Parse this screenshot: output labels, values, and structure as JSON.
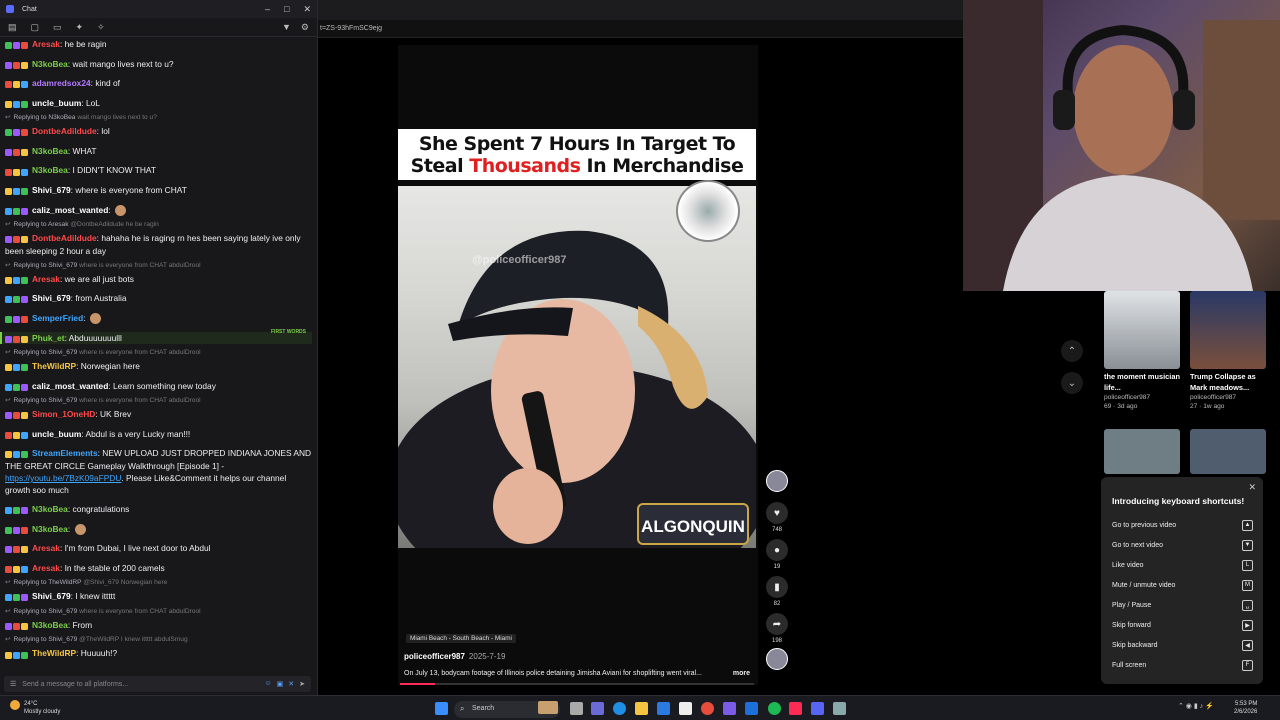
{
  "chat": {
    "window_title": "Chat",
    "input_placeholder": "Send a message to all platforms...",
    "messages": [
      {
        "user": "Aresak",
        "color": "#ff4a4a",
        "text": "he be ragin"
      },
      {
        "user": "N3koBea",
        "color": "#7bcf48",
        "text": "wait mango lives next to u?"
      },
      {
        "user": "adamredsox24",
        "color": "#b47aff",
        "text": "kind of"
      },
      {
        "user": "uncle_buum",
        "color": "#ffffff",
        "text": "LoL"
      },
      {
        "reply": "Replying to N3koBea",
        "reply_text": "wait mango lives next to u?"
      },
      {
        "user": "DontbeAdildude",
        "color": "#ff4a4a",
        "text": "lol"
      },
      {
        "user": "N3koBea",
        "color": "#7bcf48",
        "text": "WHAT"
      },
      {
        "user": "N3koBea",
        "color": "#7bcf48",
        "text": "I DIDN'T KNOW THAT"
      },
      {
        "user": "Shivi_679",
        "color": "#ffffff",
        "text": "where is everyone from CHAT"
      },
      {
        "user": "caliz_most_wanted",
        "color": "#ffffff",
        "text": ""
      },
      {
        "reply": "Replying to Aresak",
        "reply_text": "@DontbeAdildude he be ragin"
      },
      {
        "user": "DontbeAdildude",
        "color": "#ff4a4a",
        "text": "hahaha he is raging rn hes been saying lately ive only been sleeping 2 hour a day"
      },
      {
        "reply": "Replying to Shivi_679",
        "reply_text": "where is everyone from CHAT abdulDrool"
      },
      {
        "user": "Aresak",
        "color": "#ff4a4a",
        "text": "we are all just bots"
      },
      {
        "user": "Shivi_679",
        "color": "#ffffff",
        "text": "from Australia"
      },
      {
        "user": "SemperFried",
        "color": "#3ea6ff",
        "text": ""
      },
      {
        "user": "Phuk_et",
        "color": "#7bcf48",
        "text": "Abduuuuuuulll",
        "first": "FIRST WORDS"
      },
      {
        "reply": "Replying to Shivi_679",
        "reply_text": "where is everyone from CHAT abdulDrool"
      },
      {
        "user": "TheWildRP",
        "color": "#f5c542",
        "text": "Norwegian here"
      },
      {
        "user": "caliz_most_wanted",
        "color": "#ffffff",
        "text": "Learn something new today"
      },
      {
        "reply": "Replying to Shivi_679",
        "reply_text": "where is everyone from CHAT abdulDrool"
      },
      {
        "user": "Simon_1OneHD",
        "color": "#ff4a4a",
        "text": "UK Brev"
      },
      {
        "user": "uncle_buum",
        "color": "#ffffff",
        "text": "Abdul is a very Lucky man!!!"
      },
      {
        "user": "StreamElements",
        "color": "#3ea6ff",
        "text": "NEW UPLOAD JUST DROPPED INDIANA JONES AND THE GREAT CIRCLE Gameplay Walkthrough [Episode 1] -",
        "link": "https://youtu.be/7BzK09aFPDU",
        "after": ". Please Like&Comment it helps our channel growth soo much"
      },
      {
        "user": "N3koBea",
        "color": "#7bcf48",
        "text": "congratulations"
      },
      {
        "user": "N3koBea",
        "color": "#7bcf48",
        "text": ""
      },
      {
        "user": "Aresak",
        "color": "#ff4a4a",
        "text": "I'm from Dubai, I live next door to Abdul"
      },
      {
        "user": "Aresak",
        "color": "#ff4a4a",
        "text": "In the stable of 200 camels"
      },
      {
        "reply": "Replying to TheWildRP",
        "reply_text": "@Shivi_679 Norwegian here"
      },
      {
        "user": "Shivi_679",
        "color": "#ffffff",
        "text": "I knew ittttt"
      },
      {
        "reply": "Replying to Shivi_679",
        "reply_text": "where is everyone from CHAT abdulDrool"
      },
      {
        "user": "N3koBea",
        "color": "#7bcf48",
        "text": "From"
      },
      {
        "reply": "Replying to Shivi_679",
        "reply_text": "@TheWildRP I knew ittttt abdulSmug"
      },
      {
        "user": "TheWildRP",
        "color": "#f5c542",
        "text": "Huuuuh!?"
      }
    ]
  },
  "browser": {
    "url_fragment": "t=ZS-93hFmSC9ejg"
  },
  "video": {
    "headline_1": "She Spent 7 Hours In Target To",
    "headline_2a": "Steal ",
    "headline_2b": "Thousands",
    "headline_2c": " In Merchandise",
    "watermark": "@policeofficer987",
    "location": "Miami Beach - South Beach - Miami",
    "author": "policeofficer987",
    "date": "2025-7-19",
    "caption": "On July 13, bodycam footage of Illinois police detaining Jimisha Aviani for shoplifting went viral...",
    "more": "more",
    "likes": "748",
    "comments": "19",
    "saves": "82",
    "shares": "198",
    "progress": 0.1
  },
  "recommendations": [
    {
      "title": "the moment musician life...",
      "author": "policeofficer987",
      "meta": "69 · 3d ago"
    },
    {
      "title": "Trump Collapse as Mark meadows...",
      "author": "policeofficer987",
      "meta": "27 · 1w ago"
    }
  ],
  "shortcuts": {
    "title": "Introducing keyboard shortcuts!",
    "items": [
      {
        "label": "Go to previous video",
        "key": "▲"
      },
      {
        "label": "Go to next video",
        "key": "▼"
      },
      {
        "label": "Like video",
        "key": "L"
      },
      {
        "label": "Mute / unmute video",
        "key": "M"
      },
      {
        "label": "Play / Pause",
        "key": "␣"
      },
      {
        "label": "Skip forward",
        "key": "▶"
      },
      {
        "label": "Skip backward",
        "key": "◀"
      },
      {
        "label": "Full screen",
        "key": "F"
      }
    ]
  },
  "taskbar": {
    "temp": "24°C",
    "weather": "Mostly cloudy",
    "search": "Search",
    "time": "5:53 PM",
    "date": "2/6/2026"
  }
}
